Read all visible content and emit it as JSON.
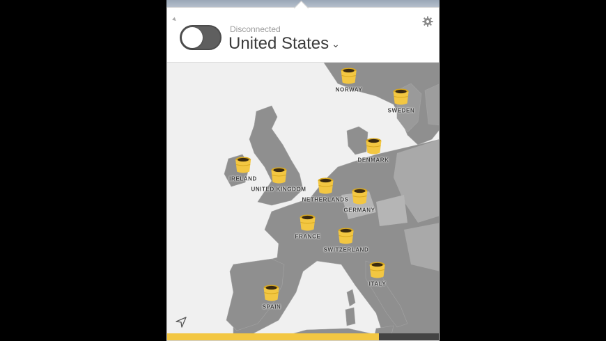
{
  "header": {
    "status": "Disconnected",
    "selected_country": "United States",
    "toggle_on": false
  },
  "map": {
    "markers": [
      {
        "label": "NORWAY"
      },
      {
        "label": "SWEDEN"
      },
      {
        "label": "DENMARK"
      },
      {
        "label": "IRELAND"
      },
      {
        "label": "UNITED KINGDOM"
      },
      {
        "label": "NETHERLANDS"
      },
      {
        "label": "GERMANY"
      },
      {
        "label": "FRANCE"
      },
      {
        "label": "SWITZERLAND"
      },
      {
        "label": "ITALY"
      },
      {
        "label": "SPAIN"
      }
    ]
  },
  "icons": {
    "settings": "gear-icon",
    "locate": "location-arrow-icon",
    "dropdown": "chevron-down-icon",
    "marker": "barrel-icon"
  },
  "colors": {
    "accent": "#f3c742",
    "land": "#8f8f8f",
    "sea": "#f0f0f0"
  },
  "progress": 0.78
}
